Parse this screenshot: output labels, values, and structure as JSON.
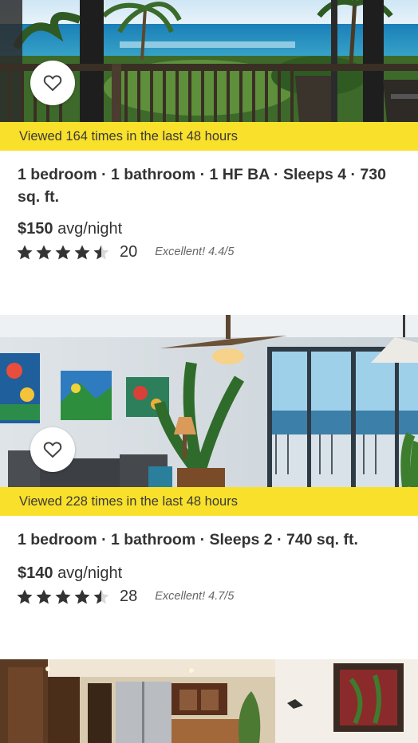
{
  "listings": [
    {
      "photo": "balcony-ocean-view-photo",
      "favorite_icon": "heart-outline-icon",
      "banner": "Viewed 164 times in the last 48 hours",
      "summary": "1 bedroom · 1 bathroom · 1 HF BA · Sleeps 4 · 730 sq. ft.",
      "price_amount": "$150",
      "price_unit": "avg/night",
      "stars": 4.5,
      "review_count": "20",
      "rating_text": "Excellent! 4.4/5"
    },
    {
      "photo": "living-room-interior-photo",
      "favorite_icon": "heart-outline-icon",
      "banner": "Viewed 228 times in the last 48 hours",
      "summary": "1 bedroom · 1 bathroom · Sleeps 2 · 740 sq. ft.",
      "price_amount": "$140",
      "price_unit": "avg/night",
      "stars": 4.5,
      "review_count": "28",
      "rating_text": "Excellent! 4.7/5"
    },
    {
      "photo": "kitchen-interior-photo"
    }
  ],
  "colors": {
    "banner_bg": "#f9e02a",
    "star": "#333333"
  }
}
